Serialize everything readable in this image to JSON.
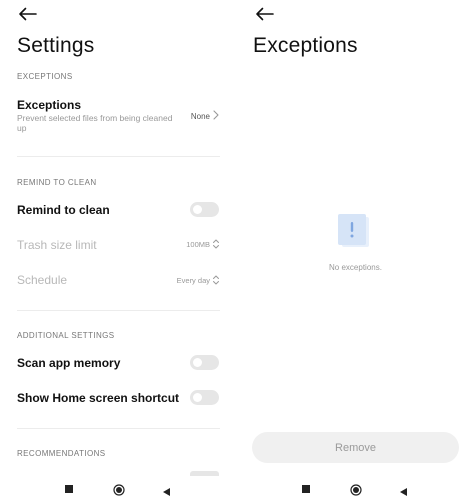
{
  "settings": {
    "title": "Settings",
    "exceptions_section": "EXCEPTIONS",
    "exceptions_row": {
      "title": "Exceptions",
      "subtitle": "Prevent selected files from being cleaned up",
      "value": "None"
    },
    "remind_section": "REMIND TO CLEAN",
    "remind_row": {
      "title": "Remind to clean",
      "enabled": false
    },
    "trash_row": {
      "title": "Trash size limit",
      "value": "100MB"
    },
    "schedule_row": {
      "title": "Schedule",
      "value": "Every day"
    },
    "additional_section": "ADDITIONAL SETTINGS",
    "scan_row": {
      "title": "Scan app memory",
      "enabled": false
    },
    "shortcut_row": {
      "title": "Show Home screen shortcut",
      "enabled": false
    },
    "recommendations_section": "RECOMMENDATIONS"
  },
  "exceptions_screen": {
    "title": "Exceptions",
    "empty_text": "No exceptions.",
    "remove_label": "Remove"
  },
  "colors": {
    "toggle_off": "#e6e6e6",
    "empty_icon_back": "#e8f0fb",
    "empty_icon_front": "#d6e4f7",
    "empty_icon_mark": "#7fa6e0"
  },
  "icons": {
    "back": "arrow-left-icon",
    "chevron": "chevron-right-icon",
    "updown": "chevron-up-down-icon",
    "empty": "exclamation-document-icon",
    "nav": [
      "recents-square-icon",
      "home-circle-icon",
      "back-triangle-icon"
    ]
  }
}
